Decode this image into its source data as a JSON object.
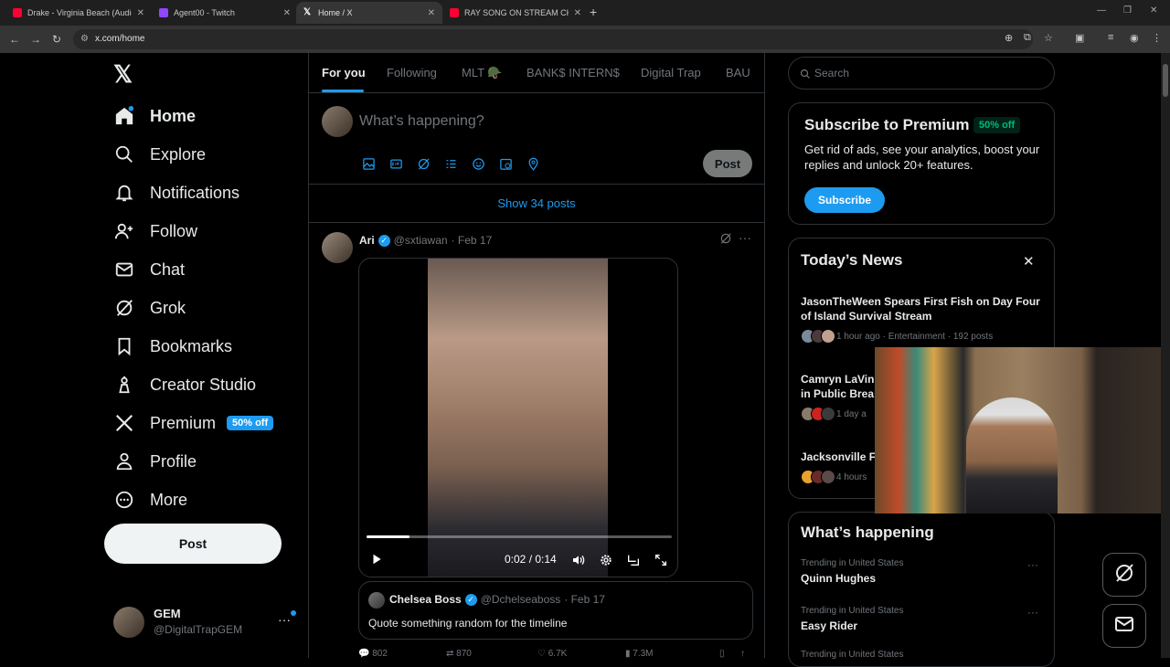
{
  "browser": {
    "tabs": [
      {
        "title": "Drake - Virginia Beach (Audio)",
        "favicon_color": "#ff0033"
      },
      {
        "title": "Agent00 - Twitch",
        "favicon_color": "#9146ff"
      },
      {
        "title": "Home / X",
        "favicon_color": "#ffffff"
      },
      {
        "title": "RAY SONG ON STREAM CHRIS...",
        "favicon_color": "#ff0033"
      }
    ],
    "url": "x.com/home"
  },
  "nav": {
    "items": [
      {
        "label": "Home",
        "icon": "home-icon"
      },
      {
        "label": "Explore",
        "icon": "search-icon"
      },
      {
        "label": "Notifications",
        "icon": "bell-icon"
      },
      {
        "label": "Follow",
        "icon": "add-person-icon"
      },
      {
        "label": "Chat",
        "icon": "mail-icon"
      },
      {
        "label": "Grok",
        "icon": "grok-icon"
      },
      {
        "label": "Bookmarks",
        "icon": "bookmark-icon"
      },
      {
        "label": "Creator Studio",
        "icon": "creator-icon"
      },
      {
        "label": "Premium",
        "icon": "x-icon"
      },
      {
        "label": "Profile",
        "icon": "person-icon"
      },
      {
        "label": "More",
        "icon": "more-circle-icon"
      }
    ],
    "premium_badge": "50% off",
    "post_label": "Post",
    "account": {
      "name": "GEM",
      "handle": "@DigitalTrapGEM"
    }
  },
  "feed": {
    "tabs": [
      "For you",
      "Following",
      "MLT 🪖",
      "BANK$ INTERN$",
      "Digital Trap",
      "BAU"
    ],
    "compose_placeholder": "What’s happening?",
    "compose_post": "Post",
    "show_posts": "Show 34 posts",
    "tweet": {
      "name": "Ari",
      "handle": "@sxtiawan",
      "date": "· Feb 17",
      "video_time": "0:02 / 0:14",
      "video_progress": 0.14,
      "quote": {
        "name": "Chelsea Boss",
        "handle": "@Dchelseaboss",
        "date": "· Feb 17",
        "text": "Quote something random for the timeline"
      },
      "actions": [
        "802",
        "870",
        "6.7K",
        "7.3M"
      ]
    }
  },
  "right": {
    "search_placeholder": "Search",
    "premium": {
      "title": "Subscribe to Premium",
      "badge": "50% off",
      "desc": "Get rid of ads, see your analytics, boost your replies and unlock 20+ features.",
      "button": "Subscribe"
    },
    "news": {
      "title": "Today’s News",
      "items": [
        {
          "headline": "JasonTheWeen Spears First Fish on Day Four of Island Survival Stream",
          "meta": "1 hour ago · Entertainment · 192 posts"
        },
        {
          "headline": "Camryn LaVin",
          "headline2": "in Public Brea",
          "meta": "1 day a"
        },
        {
          "headline": "Jacksonville F",
          "meta": "4 hours"
        }
      ]
    },
    "happening": {
      "title": "What’s happening",
      "trends": [
        {
          "context": "Trending in United States",
          "name": "Quinn Hughes"
        },
        {
          "context": "Trending in United States",
          "name": "Easy Rider"
        },
        {
          "context": "Trending in United States",
          "name": ""
        }
      ]
    }
  }
}
